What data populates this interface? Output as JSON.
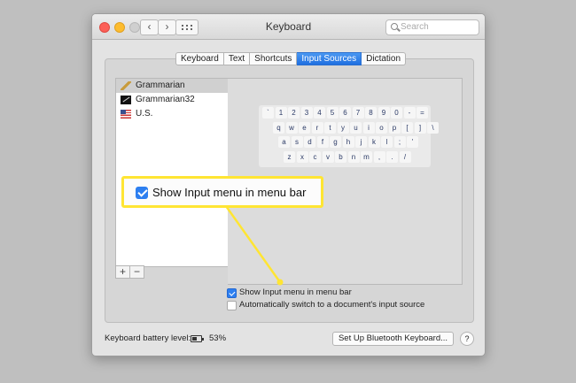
{
  "window": {
    "title": "Keyboard",
    "nav_back": "‹",
    "nav_forward": "›",
    "search_placeholder": "Search"
  },
  "tabs": [
    {
      "label": "Keyboard",
      "active": false
    },
    {
      "label": "Text",
      "active": false
    },
    {
      "label": "Shortcuts",
      "active": false
    },
    {
      "label": "Input Sources",
      "active": true
    },
    {
      "label": "Dictation",
      "active": false
    }
  ],
  "sources": [
    {
      "label": "Grammarian",
      "icon": "pen-icon",
      "selected": true
    },
    {
      "label": "Grammarian32",
      "icon": "grammarian-app-icon",
      "selected": false
    },
    {
      "label": "U.S.",
      "icon": "us-flag-icon",
      "selected": false
    }
  ],
  "keyboard_rows": [
    [
      "`",
      "1",
      "2",
      "3",
      "4",
      "5",
      "6",
      "7",
      "8",
      "9",
      "0",
      "-",
      "="
    ],
    [
      "q",
      "w",
      "e",
      "r",
      "t",
      "y",
      "u",
      "i",
      "o",
      "p",
      "[",
      "]",
      "\\"
    ],
    [
      "a",
      "s",
      "d",
      "f",
      "g",
      "h",
      "j",
      "k",
      "l",
      ";",
      "'"
    ],
    [
      "z",
      "x",
      "c",
      "v",
      "b",
      "n",
      "m",
      ",",
      ".",
      "/"
    ]
  ],
  "list_controls": {
    "add": "+",
    "remove": "−"
  },
  "options": {
    "show_input_menu": {
      "label": "Show Input menu in menu bar",
      "checked": true
    },
    "auto_switch": {
      "label": "Automatically switch to a document's input source",
      "checked": false
    }
  },
  "footer": {
    "battery_label": "Keyboard battery level:",
    "battery_value": "53%",
    "battery_fraction": 0.53,
    "bluetooth_button": "Set Up Bluetooth Keyboard...",
    "help": "?"
  },
  "callout": {
    "label": "Show Input menu in menu bar",
    "checked": true
  },
  "colors": {
    "accent": "#2d7ff0",
    "callout_border": "#ffe533",
    "background": "#bfbfbf"
  }
}
